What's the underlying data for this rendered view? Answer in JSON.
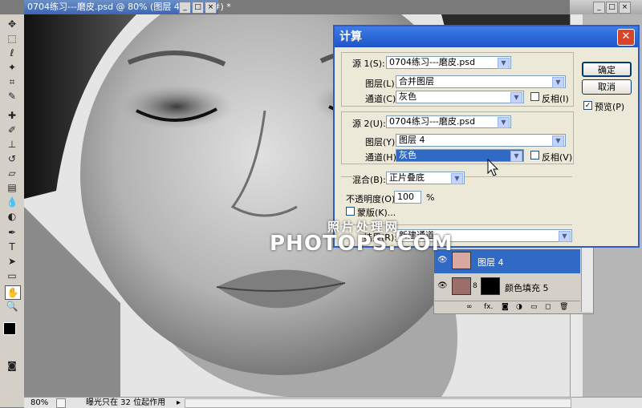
{
  "document": {
    "title": "0704练习---磨皮.psd @ 80% (图层 4, RGB/8#) *",
    "zoom": "80%",
    "status_text": "曝光只在 32 位起作用"
  },
  "window_buttons": {
    "minimize": "_",
    "restore": "□",
    "close": "×"
  },
  "layers_panel": {
    "rows": [
      {
        "name": "图层 4",
        "selected": true
      },
      {
        "name": "颜色填充 5",
        "selected": false
      }
    ],
    "bottom_icons": [
      "link-icon",
      "fx-icon",
      "mask-icon",
      "adjustment-icon",
      "group-icon",
      "new-layer-icon",
      "trash-icon"
    ],
    "fx_label": "fx."
  },
  "dialog": {
    "title": "计算",
    "close_glyph": "✕",
    "source1": {
      "label": "源 1(S):",
      "file": "0704练习---磨皮.psd",
      "layer_label": "图层(L):",
      "layer": "合并图层",
      "channel_label": "通道(C):",
      "channel": "灰色",
      "invert_label": "反相(I)"
    },
    "source2": {
      "label": "源 2(U):",
      "file": "0704练习---磨皮.psd",
      "layer_label": "图层(Y):",
      "layer": "图层 4",
      "channel_label": "通道(H):",
      "channel": "灰色",
      "invert_label": "反相(V)"
    },
    "blending": {
      "label": "混合(B):",
      "mode": "正片叠底",
      "opacity_label": "不透明度(O):",
      "opacity": "100",
      "opacity_unit": "%",
      "mask_label": "蒙版(K)..."
    },
    "result": {
      "label": "结果(R):",
      "value": "新建通道"
    },
    "ok_label": "确定",
    "cancel_label": "取消",
    "preview_label": "预览(P)",
    "preview_checked": true
  },
  "watermark": {
    "line1": "照片处理网",
    "line2": "PHOTOPS.COM"
  },
  "colors": {
    "selection": "#316ac5",
    "xp_title": "#1f55c8"
  }
}
